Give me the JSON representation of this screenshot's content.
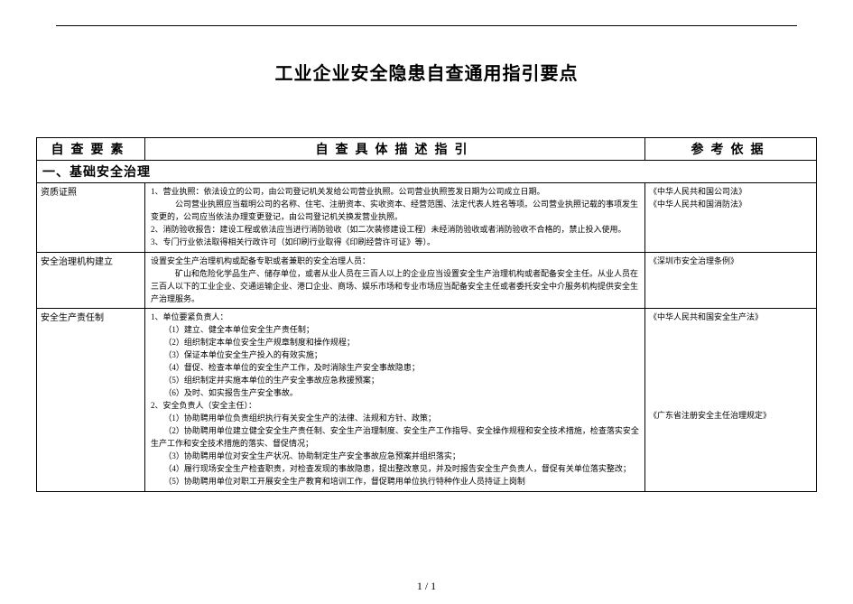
{
  "doc": {
    "title": "工业企业安全隐患自查通用指引要点",
    "page_num": "1 / 1",
    "header": {
      "c1": "自查要素",
      "c2": "自查具体描述指引",
      "c3": "参考依据"
    },
    "section1": "一、基础安全治理",
    "rows": [
      {
        "label": "资质证照",
        "desc": {
          "l1": "1、营业执照：依法设立的公司，由公司登记机关发给公司营业执照。公司营业执照签发日期为公司成立日期。",
          "l2": "公司营业执照应当载明公司的名称、住宅、注册资本、实收资本、经营范围、法定代表人姓名等项。公司营业执照记载的事项发生变更的，公司应当依法办理变更登记，由公司登记机关换发营业执照。",
          "l3": "2、消防验收报告：建设工程或依法应当进行消防验收（如二次装修建设工程）未经消防验收或者消防验收不合格的，禁止投入使用。",
          "l4": "3、专门行业依法取得相关行政许可（如印刷行业取得《印刷经营许可证》等）。"
        },
        "ref": {
          "r1": "《中华人民共和国公司法》",
          "r2": "《中华人民共和国消防法》"
        }
      },
      {
        "label": "安全治理机构建立",
        "desc": {
          "l1": "设置安全生产治理机构或配备专职或者兼职的安全治理人员：",
          "l2": "矿山和危险化学品生产、储存单位，或者从业人员在三百人以上的企业应当设置安全生产治理机构或者配备安全主任。从业人员在三百人以下的工业企业、交通运输企业、港口企业、商场、娱乐市场和专业市场应当配备安全主任或者委托安全中介服务机构提供安全生产治理服务。"
        },
        "ref": {
          "r1": "《深圳市安全治理条例》"
        }
      },
      {
        "label": "安全生产责任制",
        "desc": {
          "l1": "1、单位要紧负责人：",
          "l2": "（1）建立、健全本单位安全生产责任制；",
          "l3": "（2）组织制定本单位安全生产规章制度和操作规程；",
          "l4": "（3）保证本单位安全生产投入的有效实施；",
          "l5": "（4）督促、检查本单位的安全生产工作，及时消除生产安全事故隐患；",
          "l6": "（5）组织制定并实施本单位的生产安全事故应急救援预案；",
          "l7": "（6）及时、如实报告生产安全事故。",
          "l8": "2、安全负责人（安全主任）：",
          "l9": "（1）协助聘用单位负责组织执行有关安全生产的法律、法规和方针、政策；",
          "l10": "（2）协助聘用单位建立健全安全生产责任制、安全生产治理制度、安全生产工作指导、安全操作规程和安全技术措施，检查落实安全生产工作和安全技术措施的落实、督促情况；",
          "l11": "（3）协助聘用单位对安全生产状况、协助制定生产安全事故应急预案并组织落实；",
          "l12": "（4）履行现场安全生产检查职责，对检查发现的事故隐患，提出整改意见，并及时报告安全生产负责人，督促有关单位落实整改；",
          "l13": "（5）协助聘用单位对职工开展安全生产教育和培训工作，督促聘用单位执行特种作业人员持证上岗制"
        },
        "ref": {
          "r1": "《中华人民共和国安全生产法》",
          "r2": "《广东省注册安全主任治理规定》"
        }
      }
    ]
  }
}
